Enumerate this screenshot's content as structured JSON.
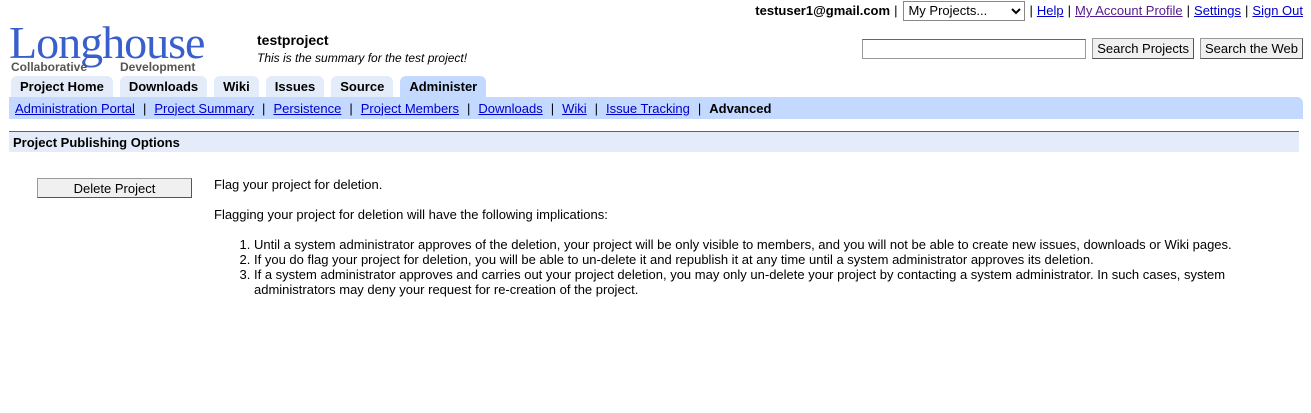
{
  "user": {
    "email": "testuser1@gmail.com",
    "projects_select": "My Projects...",
    "links": [
      "Help",
      "My Account Profile",
      "Settings",
      "Sign Out"
    ],
    "sep": "|"
  },
  "logo": {
    "word": "Longhouse",
    "sub_left": "Collaborative",
    "sub_right": "Development"
  },
  "project": {
    "name": "testproject",
    "summary": "This is the summary for the test project!"
  },
  "search": {
    "value": "",
    "search_projects_label": "Search Projects",
    "search_web_label": "Search the Web"
  },
  "tabs": [
    {
      "label": "Project Home"
    },
    {
      "label": "Downloads"
    },
    {
      "label": "Wiki"
    },
    {
      "label": "Issues"
    },
    {
      "label": "Source"
    },
    {
      "label": "Administer",
      "active": true
    }
  ],
  "subnav": {
    "links": [
      "Administration Portal",
      "Project Summary",
      "Persistence",
      "Project Members",
      "Downloads",
      "Wiki",
      "Issue Tracking"
    ],
    "current": "Advanced",
    "sep": "|"
  },
  "section": {
    "title": "Project Publishing Options"
  },
  "main": {
    "delete_label": "Delete Project",
    "flag_text": "Flag your project for deletion.",
    "implications_intro": "Flagging your project for deletion will have the following implications:",
    "implications": [
      "Until a system administrator approves of the deletion, your project will be only visible to members, and you will not be able to create new issues, downloads or Wiki pages.",
      "If you do flag your project for deletion, you will be able to un-delete it and republish it at any time until a system administrator approves its deletion.",
      "If a system administrator approves and carries out your project deletion, you may only un-delete your project by contacting a system administrator. In such cases, system administrators may deny your request for re-creation of the project."
    ]
  }
}
